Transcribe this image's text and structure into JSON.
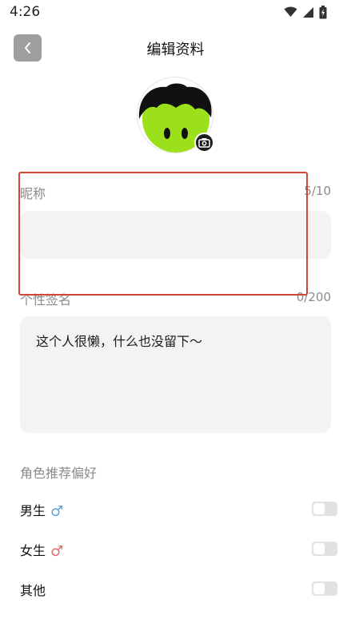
{
  "status_bar": {
    "time": "4:26"
  },
  "header": {
    "title": "编辑资料",
    "back_icon": "chevron-left-icon"
  },
  "avatar": {
    "camera_icon": "camera-icon"
  },
  "nickname": {
    "label": "昵称",
    "count": "5/10",
    "value": ""
  },
  "signature": {
    "label": "个性签名",
    "count": "0/200",
    "value": "这个人很懒，什么也没留下～"
  },
  "preferences": {
    "title": "角色推荐偏好",
    "items": [
      {
        "label": "男生",
        "icon": "♂",
        "icon_color": "#5aa3e0",
        "enabled": false
      },
      {
        "label": "女生",
        "icon": "♂",
        "icon_color": "#e86a6a",
        "enabled": false
      },
      {
        "label": "其他",
        "icon": "",
        "enabled": false
      }
    ]
  },
  "colors": {
    "highlight": "#d0473a",
    "input_bg": "#f3f3f3",
    "back_button": "#9e9e9e"
  }
}
